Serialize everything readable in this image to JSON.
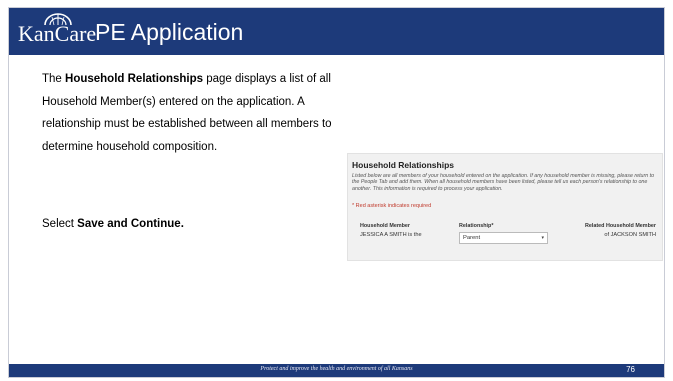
{
  "header": {
    "logo_text": "KanCare",
    "title": "PE Application"
  },
  "body": {
    "intro_prefix": "The ",
    "intro_bold": "Household Relationships",
    "intro_rest": " page displays a list of all Household Member(s) entered on the application. A relationship must be established between all members to determine household composition.",
    "select_prefix": "Select ",
    "select_bold": "Save and Continue."
  },
  "panel": {
    "title": "Household Relationships",
    "description": "Listed below are all members of your household entered on the application. If any household member is missing, please return to the People Tab and add them. When all household members have been listed, please tell us each person's relationship to one another. This information is required to process your application.",
    "required_note": "* Red asterisk indicates required",
    "col_member": "Household Member",
    "col_relationship": "Relationship*",
    "col_related": "Related Household Member",
    "row_member": "JESSICA A SMITH is the",
    "row_relationship": "Parent",
    "row_related": "of JACKSON SMITH"
  },
  "footer": {
    "tagline": "Protect and improve the health and environment of all Kansans",
    "page_number": "76"
  },
  "colors": {
    "brand_navy": "#1d3a7a",
    "required_red": "#c0392b"
  }
}
